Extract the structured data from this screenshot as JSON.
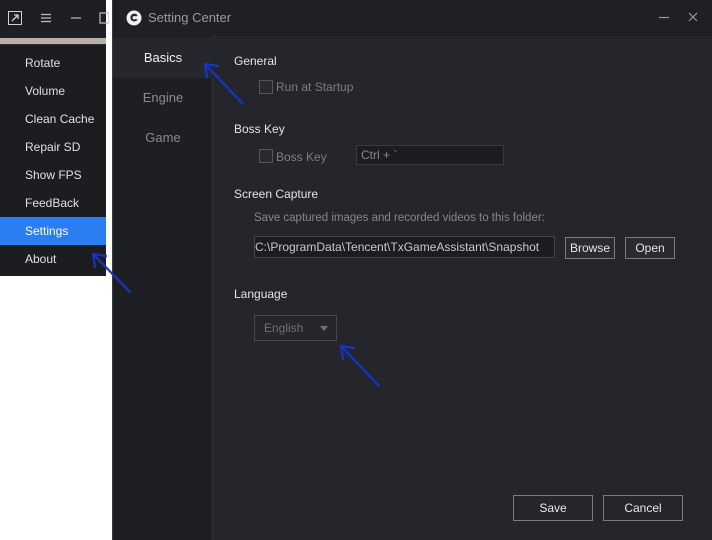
{
  "background_app": {
    "titlebar": {
      "icons": [
        "expand-icon",
        "hamburger-menu-icon",
        "minimize-icon",
        "maximize-icon"
      ]
    },
    "menu": {
      "items": [
        {
          "label": "Rotate"
        },
        {
          "label": "Volume"
        },
        {
          "label": "Clean Cache"
        },
        {
          "label": "Repair SD"
        },
        {
          "label": "Show FPS"
        },
        {
          "label": "FeedBack"
        },
        {
          "label": "Settings",
          "selected": true
        },
        {
          "label": "About"
        }
      ]
    }
  },
  "window": {
    "title": "Setting Center",
    "icons": [
      "app-logo-icon",
      "minimize-icon",
      "close-icon"
    ]
  },
  "nav": {
    "items": [
      {
        "label": "Basics",
        "selected": true
      },
      {
        "label": "Engine"
      },
      {
        "label": "Game"
      }
    ]
  },
  "general": {
    "heading": "General",
    "run_at_startup_label": "Run at Startup",
    "run_at_startup_checked": false
  },
  "boss_key": {
    "heading": "Boss Key",
    "checkbox_label": "Boss Key",
    "checked": false,
    "hotkey_value": "Ctrl + `"
  },
  "screen_capture": {
    "heading": "Screen Capture",
    "hint": "Save captured images and recorded videos to this folder:",
    "path_value": "C:\\ProgramData\\Tencent\\TxGameAssistant\\Snapshot",
    "browse_label": "Browse",
    "open_label": "Open"
  },
  "language": {
    "heading": "Language",
    "selected": "English"
  },
  "footer": {
    "save_label": "Save",
    "cancel_label": "Cancel"
  },
  "colors": {
    "accent": "#2c7cf2",
    "window_bg": "#25262b",
    "sidebar_bg": "#1e1f24",
    "annotation_arrow": "#1534c8"
  }
}
